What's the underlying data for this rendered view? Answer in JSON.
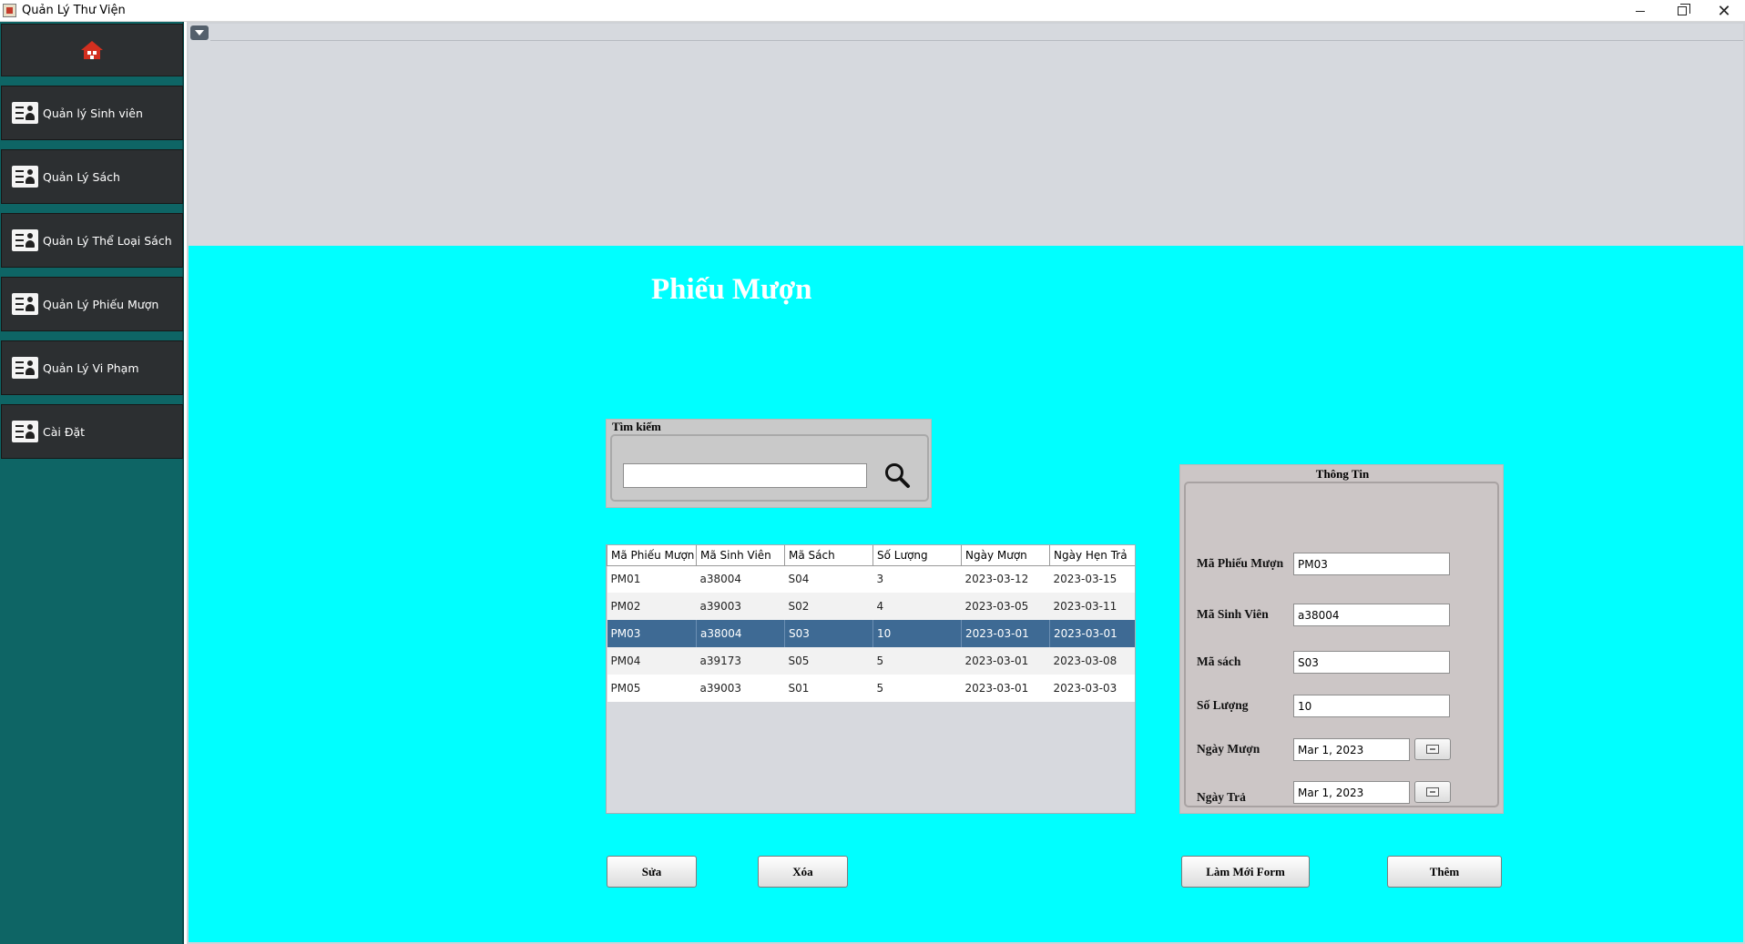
{
  "window": {
    "title": "Quản Lý Thư Viện",
    "controls": {
      "minimize": "—",
      "maximize": "❐",
      "close": "✕"
    }
  },
  "sidebar": {
    "home_icon": "home-icon",
    "items": [
      {
        "label": "Quản lý Sinh viên",
        "icon": "user-card-icon"
      },
      {
        "label": "Quản Lý Sách",
        "icon": "user-card-icon"
      },
      {
        "label": "Quản Lý Thể Loại Sách",
        "icon": "user-card-icon"
      },
      {
        "label": "Quản Lý Phiếu Mượn",
        "icon": "user-card-icon"
      },
      {
        "label": "Quản Lý Vi Phạm",
        "icon": "user-card-icon"
      },
      {
        "label": "Cài Đặt",
        "icon": "user-card-icon"
      }
    ]
  },
  "main": {
    "title": "Phiếu Mượn",
    "search": {
      "group_title": "Tìm kiếm",
      "value": "",
      "placeholder": ""
    },
    "table": {
      "columns": [
        "Mã Phiếu Mượn",
        "Mã Sinh Viên",
        "Mã Sách",
        "Số Lượng",
        "Ngày Mượn",
        "Ngày Hẹn Trả"
      ],
      "rows": [
        [
          "PM01",
          "a38004",
          "S04",
          "3",
          "2023-03-12",
          "2023-03-15"
        ],
        [
          "PM02",
          "a39003",
          "S02",
          "4",
          "2023-03-05",
          "2023-03-11"
        ],
        [
          "PM03",
          "a38004",
          "S03",
          "10",
          "2023-03-01",
          "2023-03-01"
        ],
        [
          "PM04",
          "a39173",
          "S05",
          "5",
          "2023-03-01",
          "2023-03-08"
        ],
        [
          "PM05",
          "a39003",
          "S01",
          "5",
          "2023-03-01",
          "2023-03-03"
        ]
      ],
      "selected_row": 2
    },
    "info": {
      "group_title": "Thông Tin",
      "ma_phieu_muon": {
        "label": "Mã Phiếu Mượn",
        "value": "PM03"
      },
      "ma_sinh_vien": {
        "label": "Mã Sinh Viên",
        "value": "a38004"
      },
      "ma_sach": {
        "label": "Mã sách",
        "value": "S03"
      },
      "so_luong": {
        "label": "Số Lượng",
        "value": "10"
      },
      "ngay_muon": {
        "label": "Ngày Mượn",
        "value": "Mar 1, 2023"
      },
      "ngay_tra": {
        "label": "Ngày Trả",
        "value": "Mar 1, 2023"
      }
    },
    "buttons": {
      "sua": "Sửa",
      "xoa": "Xóa",
      "lam_moi": "Làm Mới Form",
      "them": "Thêm"
    }
  },
  "colors": {
    "sidebar_bg": "#0e6565",
    "nav_item_bg": "#2c2f31",
    "main_bg": "#00ffff",
    "top_band": "#d6d9de",
    "selected_row": "#3e6a94",
    "home_icon": "#d32f1f"
  }
}
